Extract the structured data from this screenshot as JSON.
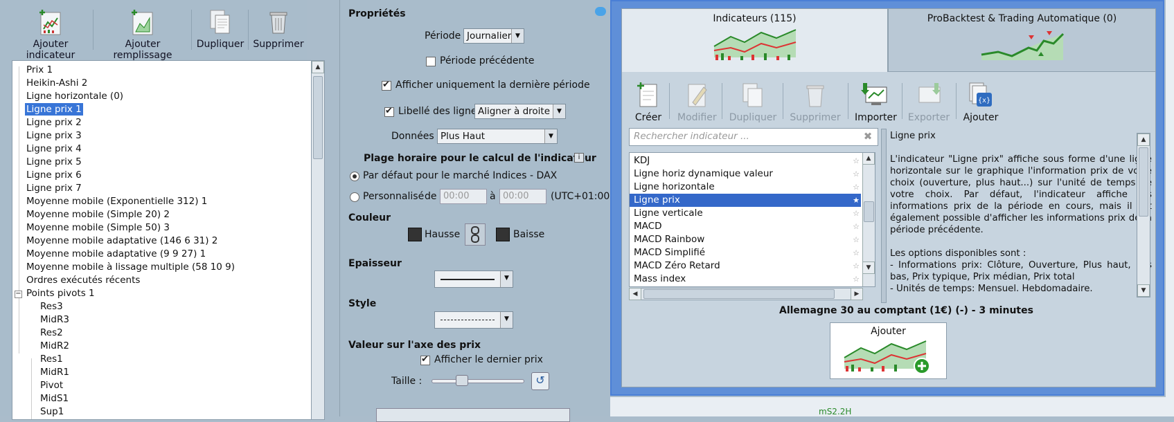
{
  "toolbar": {
    "add_indicator": "Ajouter indicateur",
    "add_fill": "Ajouter remplissage",
    "duplicate": "Dupliquer",
    "delete": "Supprimer"
  },
  "tree": {
    "items": [
      "Prix 1",
      "Heikin-Ashi 2",
      "Ligne horizontale (0)",
      "Ligne prix 1",
      "Ligne prix 2",
      "Ligne prix 3",
      "Ligne prix 4",
      "Ligne prix 5",
      "Ligne prix 6",
      "Ligne prix 7",
      "Moyenne mobile (Exponentielle 312) 1",
      "Moyenne mobile (Simple 20) 2",
      "Moyenne mobile (Simple 50) 3",
      "Moyenne mobile adaptative (146 6 31) 2",
      "Moyenne mobile adaptative (9 9 27) 1",
      "Moyenne mobile à lissage multiple (58 10 9)",
      "Ordres exécutés récents",
      "Points pivots 1"
    ],
    "pivot_children": [
      "Res3",
      "MidR3",
      "Res2",
      "MidR2",
      "Res1",
      "MidR1",
      "Pivot",
      "MidS1",
      "Sup1"
    ],
    "selected": "Ligne prix 1"
  },
  "props": {
    "title": "Propriétés",
    "period_label": "Période",
    "period_value": "Journalier",
    "prev_period": "Période précédente",
    "last_period_only": "Afficher uniquement la dernière période",
    "line_labels": "Libellé des lignes",
    "align_value": "Aligner à droite",
    "data_label": "Données",
    "data_value": "Plus Haut",
    "time_range_title": "Plage horaire pour le calcul de l'indicateur",
    "default_market": "Par défaut pour le marché Indices - DAX",
    "custom": "Personnalisé",
    "from": "de",
    "to": "à",
    "time_from": "00:00",
    "time_to": "00:00",
    "tz": "(UTC+01:00)",
    "color_title": "Couleur",
    "up": "Hausse",
    "down": "Baisse",
    "thickness_title": "Epaisseur",
    "style_title": "Style",
    "price_axis_title": "Valeur sur l'axe des prix",
    "show_last_price": "Afficher le dernier prix",
    "size_label": "Taille :",
    "slider_value": 0.3
  },
  "dialog": {
    "tab_indicators": "Indicateurs (115)",
    "tab_backtest": "ProBacktest & Trading Automatique (0)",
    "actions": {
      "create": "Créer",
      "edit": "Modifier",
      "duplicate": "Dupliquer",
      "delete": "Supprimer",
      "import": "Importer",
      "export": "Exporter",
      "add": "Ajouter"
    },
    "search_placeholder": "Rechercher indicateur ...",
    "list": [
      "KDJ",
      "Ligne horiz dynamique valeur",
      "Ligne horizontale",
      "Ligne prix",
      "Ligne verticale",
      "MACD",
      "MACD Rainbow",
      "MACD Simplifié",
      "MACD Zéro Retard",
      "Mass index"
    ],
    "selected": "Ligne prix",
    "desc_title": "Ligne prix",
    "desc_p1": "L'indicateur \"Ligne prix\" affiche sous forme d'une ligne horizontale sur le graphique l'information prix de votre choix (ouverture, plus haut...) sur l'unité de temps de votre choix. Par défaut, l'indicateur affiche les informations prix de la période en cours, mais il est également possible d'afficher les informations prix de la période précédente.",
    "desc_p2": "Les options disponibles sont :",
    "desc_p3": "- Informations prix: Clôture, Ouverture, Plus haut, Pus bas, Prix typique, Prix médian, Prix total",
    "desc_p4": "- Unités de temps: Mensuel. Hebdomadaire.",
    "instrument": "Allemagne 30 au comptant (1€) (-) - 3 minutes",
    "add_button": "Ajouter"
  },
  "background": {
    "chart_label": "mS2.2H"
  }
}
